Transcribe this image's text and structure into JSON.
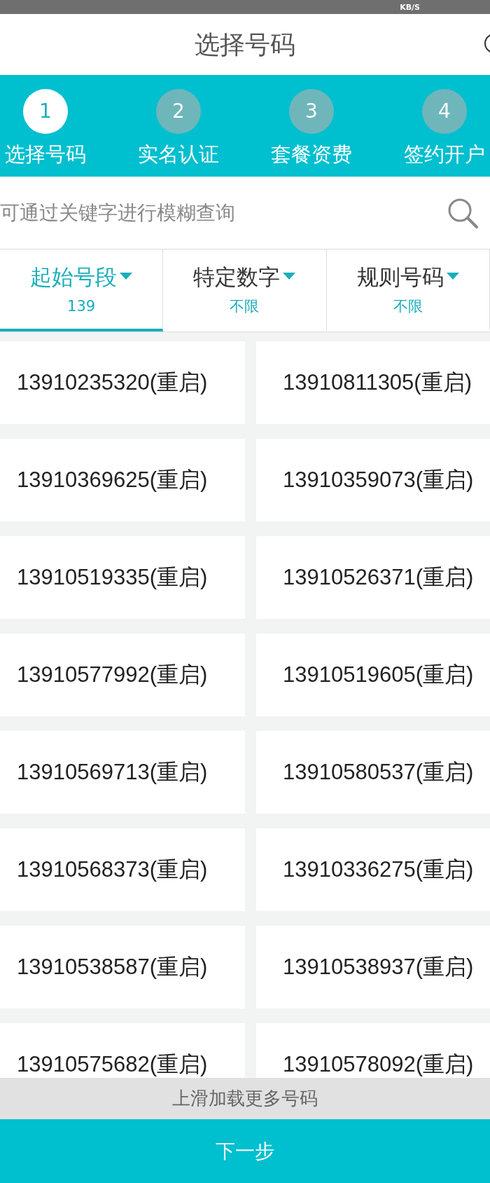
{
  "status_bar": {
    "net_speed": "KB/S"
  },
  "header": {
    "title": "选择号码"
  },
  "steps": [
    {
      "number": "1",
      "label": "选择号码",
      "selected": true
    },
    {
      "number": "2",
      "label": "实名认证",
      "selected": false
    },
    {
      "number": "3",
      "label": "套餐资费",
      "selected": false
    },
    {
      "number": "4",
      "label": "签约开户",
      "selected": false
    }
  ],
  "search": {
    "placeholder": "可通过关键字进行模糊查询"
  },
  "filters": [
    {
      "label": "起始号段",
      "value": "139",
      "selected": true
    },
    {
      "label": "特定数字",
      "value": "不限",
      "selected": false
    },
    {
      "label": "规则号码",
      "value": "不限",
      "selected": false
    }
  ],
  "numbers": [
    "13910235320(重启)",
    "13910811305(重启)",
    "13910369625(重启)",
    "13910359073(重启)",
    "13910519335(重启)",
    "13910526371(重启)",
    "13910577992(重启)",
    "13910519605(重启)",
    "13910569713(重启)",
    "13910580537(重启)",
    "13910568373(重启)",
    "13910336275(重启)",
    "13910538587(重启)",
    "13910538937(重启)",
    "13910575682(重启)",
    "13910578092(重启)"
  ],
  "load_more": "上滑加载更多号码",
  "next_button": "下一步"
}
